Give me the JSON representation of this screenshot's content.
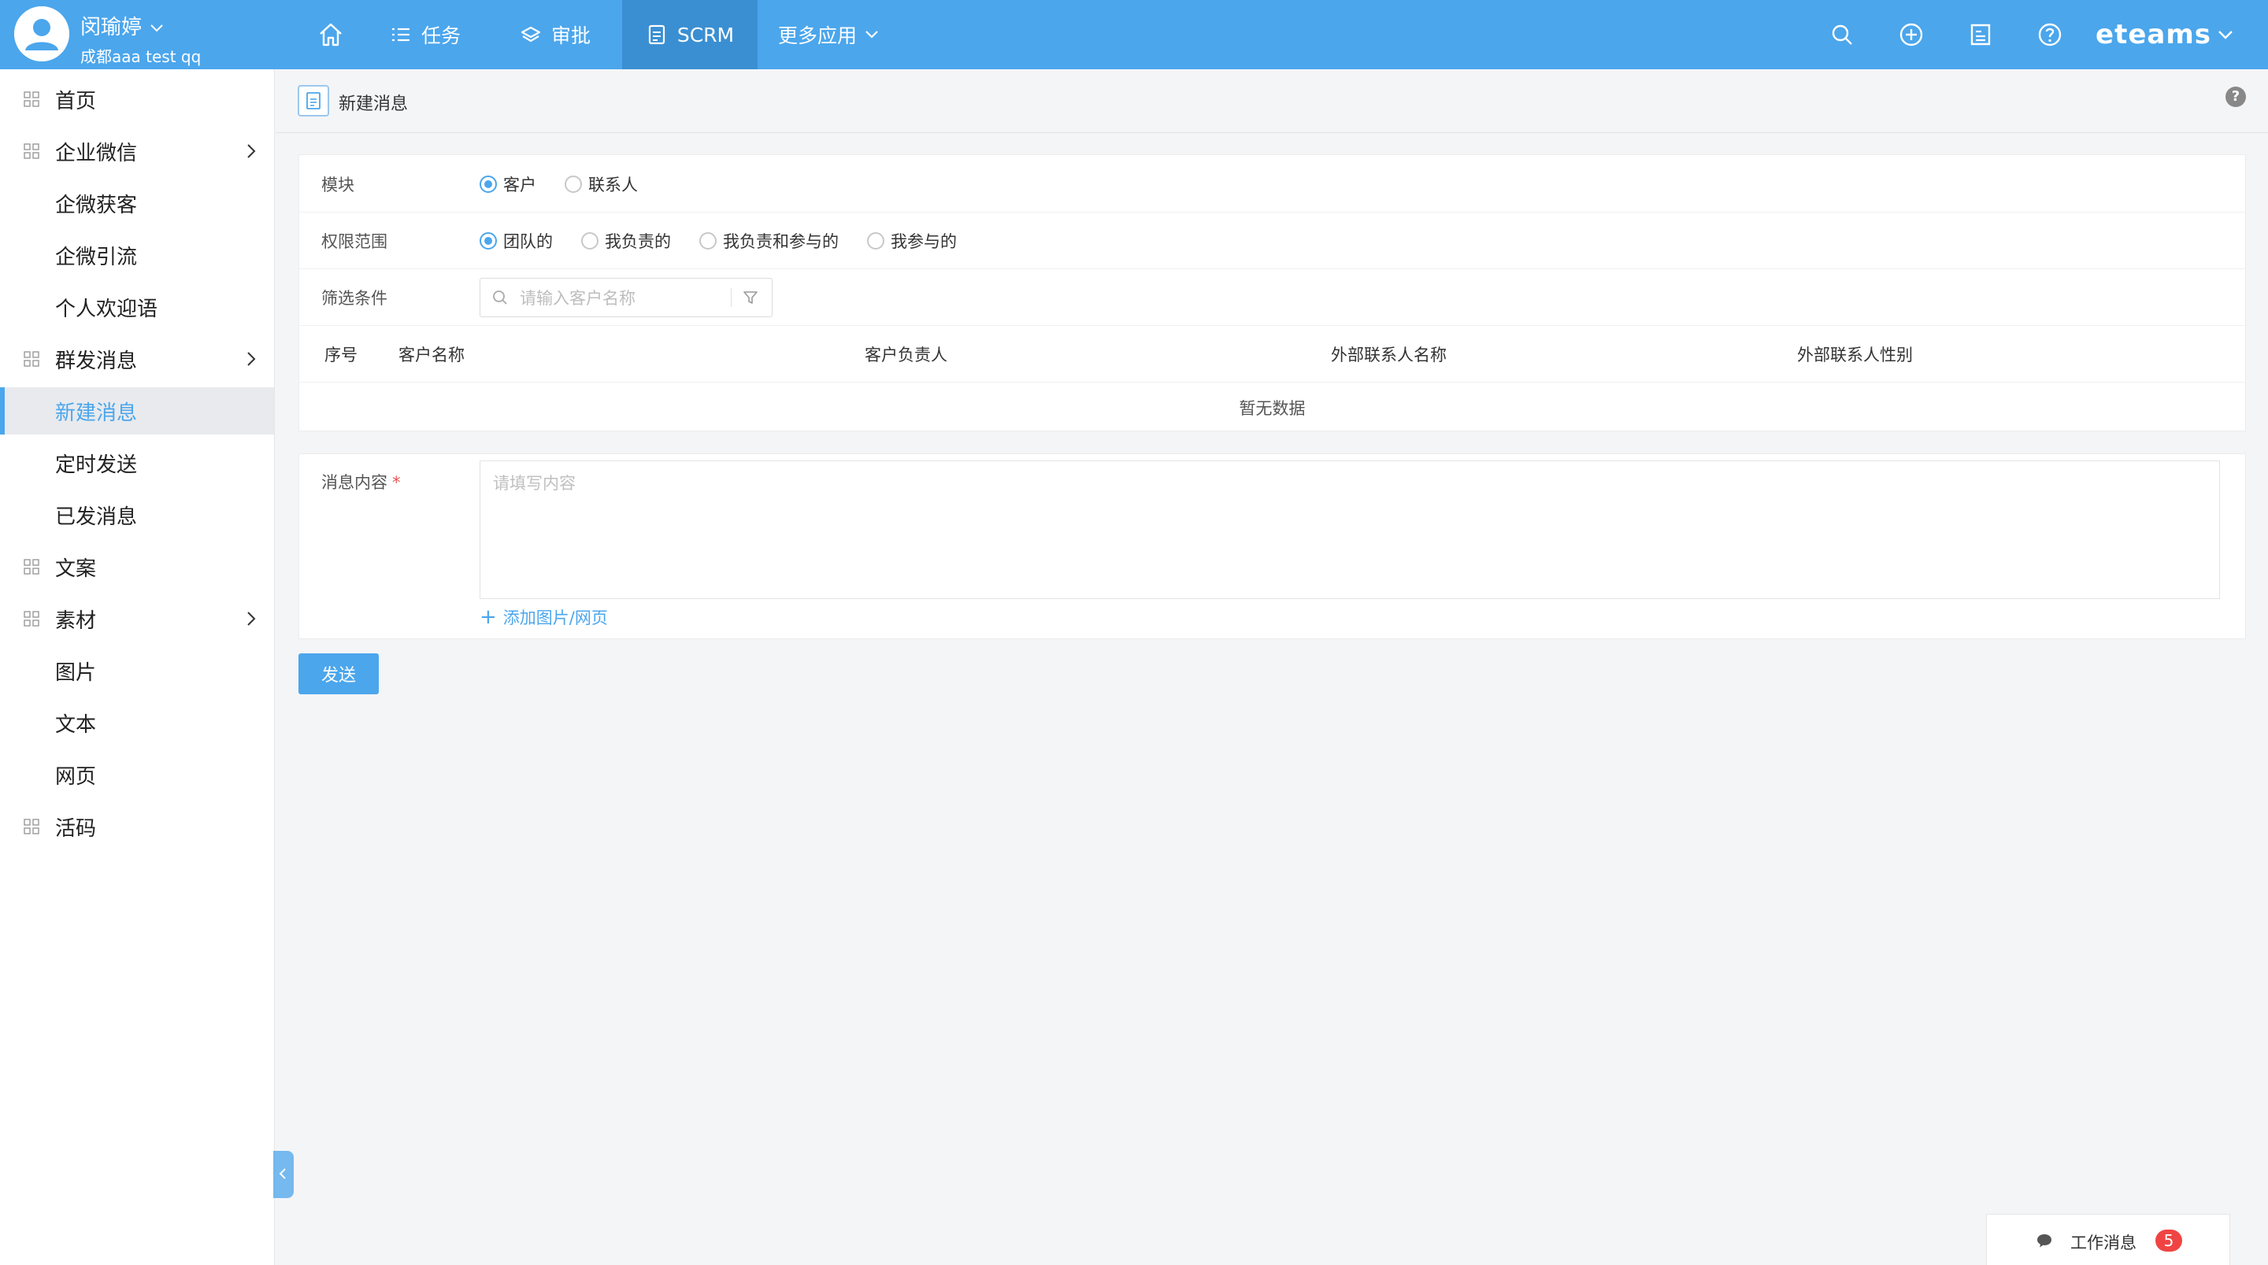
{
  "user": {
    "name": "闵瑜婷",
    "org": "成都aaa test qq"
  },
  "nav": [
    {
      "label": "",
      "icon": "home-icon"
    },
    {
      "label": "任务",
      "icon": "list-icon"
    },
    {
      "label": "审批",
      "icon": "layers-icon"
    },
    {
      "label": "SCRM",
      "icon": "document-icon",
      "active": true
    },
    {
      "label": "更多应用",
      "icon": "chevron-down-icon"
    }
  ],
  "header_icons": [
    "search-icon",
    "plus-circle-icon",
    "notes-icon",
    "help-icon"
  ],
  "brand": "eteams",
  "sidebar": {
    "items": [
      {
        "label": "首页",
        "icon": "grid-icon"
      },
      {
        "label": "企业微信",
        "icon": "grid-icon",
        "expandable": true
      },
      {
        "label": "企微获客"
      },
      {
        "label": "企微引流"
      },
      {
        "label": "个人欢迎语"
      },
      {
        "label": "群发消息",
        "icon": "grid-icon",
        "expandable": true
      },
      {
        "label": "新建消息",
        "active": true
      },
      {
        "label": "定时发送"
      },
      {
        "label": "已发消息"
      },
      {
        "label": "文案",
        "icon": "grid-icon"
      },
      {
        "label": "素材",
        "icon": "grid-icon",
        "expandable": true
      },
      {
        "label": "图片"
      },
      {
        "label": "文本"
      },
      {
        "label": "网页"
      },
      {
        "label": "活码",
        "icon": "grid-icon"
      }
    ]
  },
  "page": {
    "title": "新建消息",
    "help": "?"
  },
  "form": {
    "module": {
      "label": "模块",
      "options": [
        {
          "label": "客户",
          "checked": true
        },
        {
          "label": "联系人",
          "checked": false
        }
      ]
    },
    "scope": {
      "label": "权限范围",
      "options": [
        {
          "label": "团队的",
          "checked": true
        },
        {
          "label": "我负责的",
          "checked": false
        },
        {
          "label": "我负责和参与的",
          "checked": false
        },
        {
          "label": "我参与的",
          "checked": false
        }
      ]
    },
    "filter": {
      "label": "筛选条件",
      "placeholder": "请输入客户名称",
      "value": ""
    },
    "table": {
      "columns": [
        "序号",
        "客户名称",
        "客户负责人",
        "外部联系人名称",
        "外部联系人性别"
      ],
      "rows": [],
      "empty_text": "暂无数据"
    },
    "message": {
      "label": "消息内容",
      "required_mark": "*",
      "placeholder": "请填写内容",
      "value": "",
      "add_link": "添加图片/网页"
    },
    "submit_label": "发送"
  },
  "work_message": {
    "label": "工作消息",
    "count": "5"
  },
  "colors": {
    "primary": "#4ba6ec",
    "topbar": "#4ba6ec",
    "badge": "#f04444",
    "required": "#e8554e"
  }
}
